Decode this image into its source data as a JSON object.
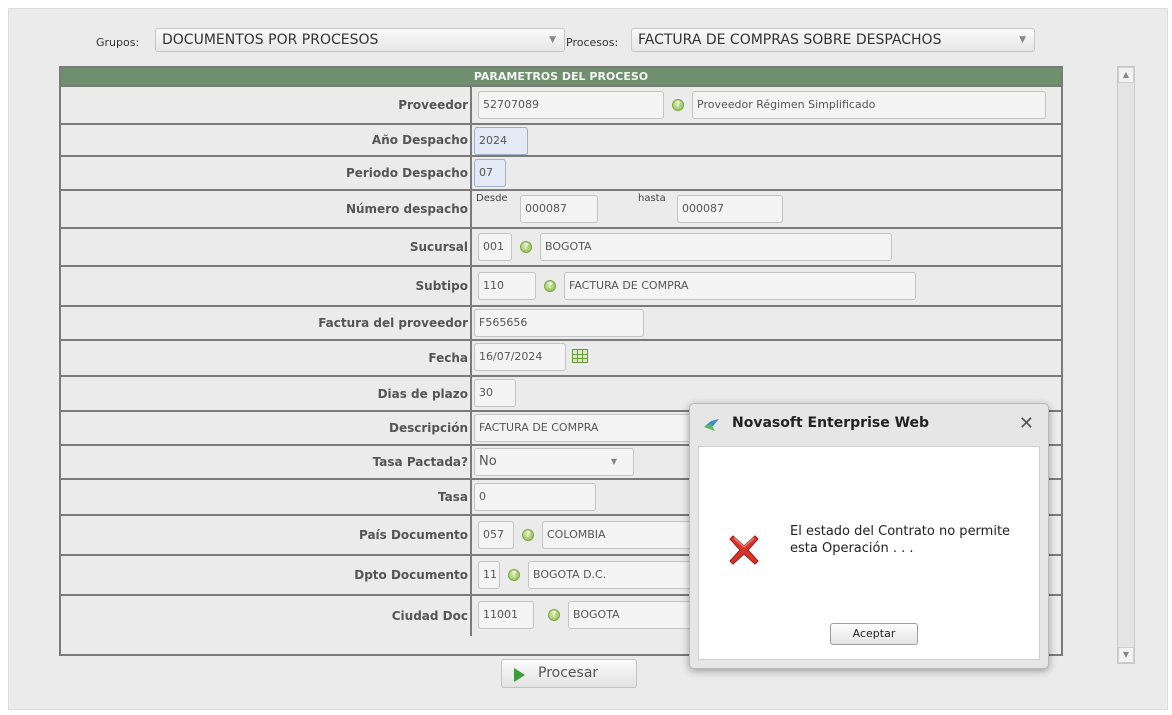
{
  "header": {
    "groups_label": "Grupos:",
    "groups_value": "DOCUMENTOS POR PROCESOS",
    "processes_label": "Procesos:",
    "processes_value": "FACTURA DE COMPRAS SOBRE DESPACHOS"
  },
  "table": {
    "title": "PARAMETROS DEL PROCESO",
    "rows": {
      "proveedor": {
        "label": "Proveedor",
        "code": "52707089",
        "desc": "Proveedor Régimen Simplificado"
      },
      "anio_despacho": {
        "label": "Año Despacho",
        "value": "2024"
      },
      "periodo_despacho": {
        "label": "Periodo Despacho",
        "value": "07"
      },
      "numero_despacho": {
        "label": "Número despacho",
        "desde_label": "Desde",
        "desde": "000087",
        "hasta_label": "hasta",
        "hasta": "000087"
      },
      "sucursal": {
        "label": "Sucursal",
        "code": "001",
        "desc": "BOGOTA"
      },
      "subtipo": {
        "label": "Subtipo",
        "code": "110",
        "desc": "FACTURA DE COMPRA"
      },
      "factura_proveedor": {
        "label": "Factura del proveedor",
        "value": "F565656"
      },
      "fecha": {
        "label": "Fecha",
        "value": "16/07/2024"
      },
      "dias_plazo": {
        "label": "Dias de plazo",
        "value": "30"
      },
      "descripcion": {
        "label": "Descripción",
        "value": "FACTURA DE COMPRA"
      },
      "tasa_pactada": {
        "label": "Tasa Pactada?",
        "value": "No"
      },
      "tasa": {
        "label": "Tasa",
        "value": "0"
      },
      "pais_documento": {
        "label": "País Documento",
        "code": "057",
        "desc": "COLOMBIA"
      },
      "dpto_documento": {
        "label": "Dpto Documento",
        "code": "11",
        "desc": "BOGOTA D.C."
      },
      "ciudad_doc": {
        "label": "Ciudad Doc",
        "code": "11001",
        "desc": "BOGOTA"
      }
    }
  },
  "actions": {
    "process_label": "Procesar"
  },
  "dialog": {
    "title": "Novasoft Enterprise Web",
    "message": "El estado del Contrato no permite esta Operación . . .",
    "ok_label": "Aceptar"
  },
  "colors": {
    "header_bar": "#6f8f6f",
    "blue_input": "#e3e9f5",
    "error_red": "#d9342b",
    "play_green": "#3d9a3d"
  }
}
